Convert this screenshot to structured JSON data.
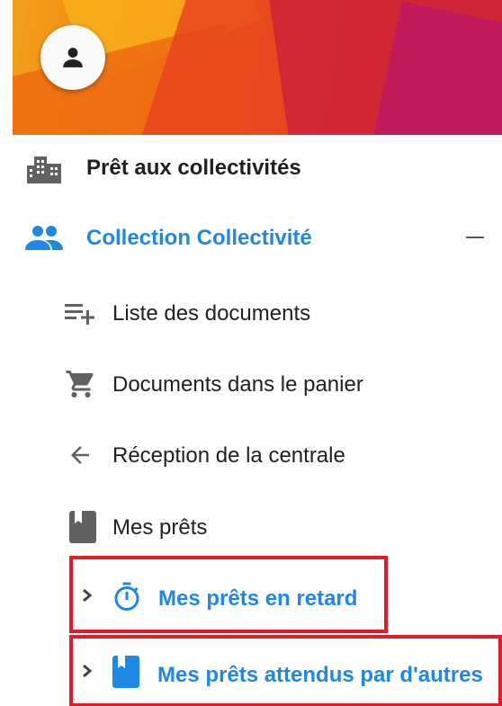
{
  "header": {
    "avatar_icon": "person-icon"
  },
  "menu": {
    "group": {
      "label": "Prêt aux collectivités",
      "icon": "building-icon"
    },
    "section": {
      "label": "Collection Collectivité",
      "icon": "people-icon",
      "collapse_icon": "minus-icon",
      "accent": "#1e88e5"
    },
    "items": [
      {
        "label": "Liste des documents",
        "icon": "playlist-add-icon"
      },
      {
        "label": "Documents dans le panier",
        "icon": "shopping-cart-icon"
      },
      {
        "label": "Réception de la centrale",
        "icon": "arrow-left-icon"
      },
      {
        "label": "Mes prêts",
        "icon": "book-icon"
      }
    ],
    "subitems": [
      {
        "label": "Mes prêts en retard",
        "icon": "timer-icon",
        "expand_icon": "chevron-right-icon"
      },
      {
        "label": "Mes prêts attendus par d'autres",
        "icon": "book-icon",
        "expand_icon": "chevron-right-icon"
      }
    ]
  },
  "highlight_color": "#e21b2a"
}
